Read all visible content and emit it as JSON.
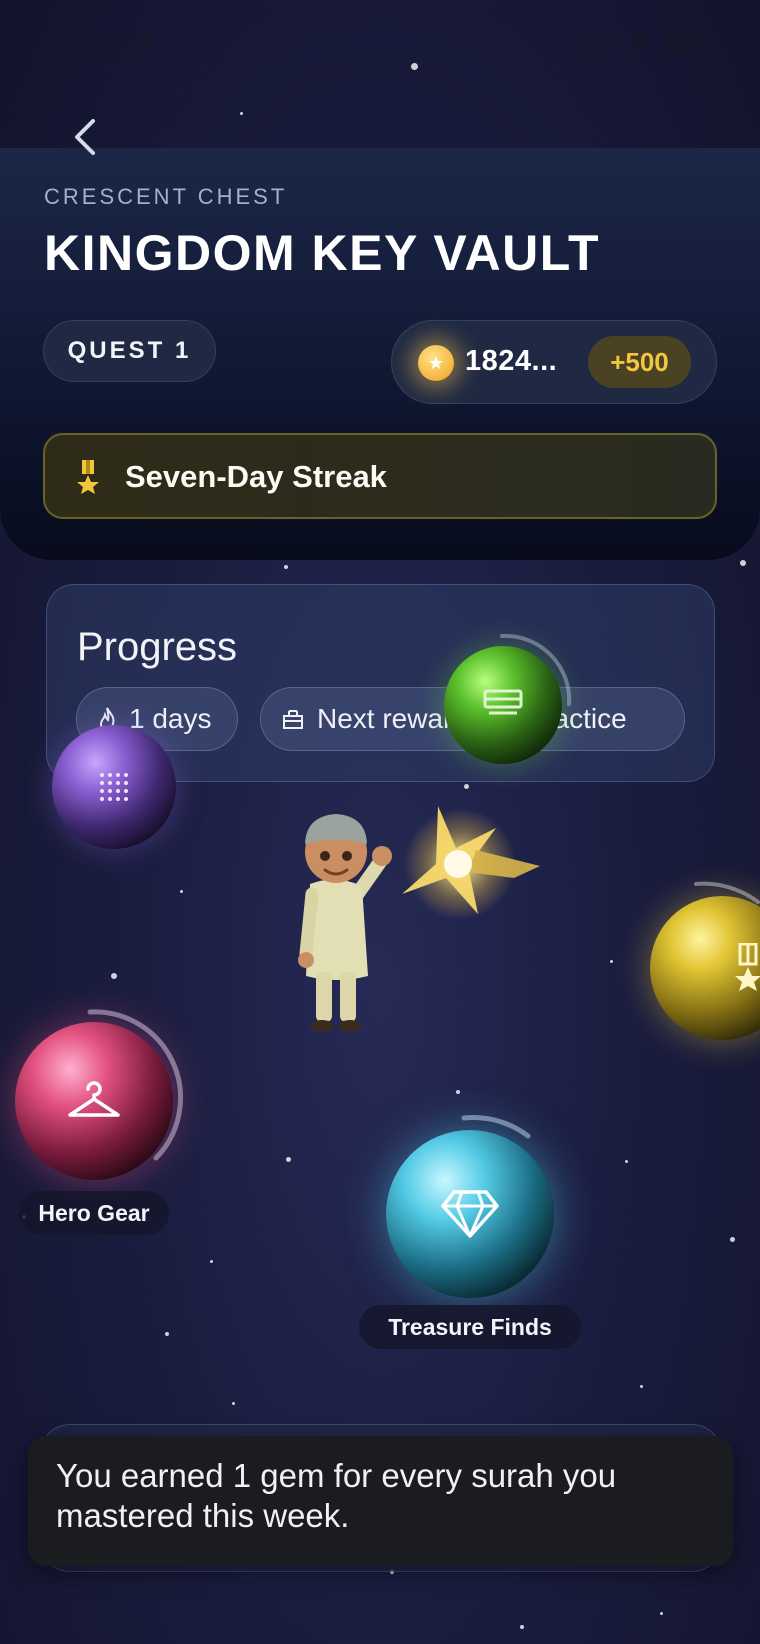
{
  "status_bar": {
    "time": "11:20"
  },
  "header": {
    "eyebrow": "CRESCENT CHEST",
    "title": "KINGDOM KEY VAULT",
    "quest_label": "QUEST 1",
    "coins": {
      "value": "1824...",
      "bonus": "+500"
    },
    "streak_label": "Seven-Day Streak"
  },
  "progress": {
    "title": "Progress",
    "days_chip": "1 days",
    "reward_chip": "Next reward in 1 practice"
  },
  "orbs": [
    {
      "name": "purple-orb",
      "icon": "dots-grid-icon",
      "color": "#8a5fd1"
    },
    {
      "name": "green-orb",
      "icon": "card-icon",
      "color": "#5cc12c",
      "progress": 0.3
    },
    {
      "name": "yellow-orb",
      "icon": "medal-icon",
      "color": "#e1c534",
      "progress": 0.15
    },
    {
      "name": "pink-orb",
      "icon": "hanger-icon",
      "color": "#e2507f",
      "label": "Hero Gear",
      "progress": 0.35
    },
    {
      "name": "cyan-orb",
      "icon": "diamond-icon",
      "color": "#54cbe6",
      "label": "Treasure Finds",
      "progress": 0.12
    }
  ],
  "toast": {
    "message": "You earned 1 gem for every surah you mastered this week."
  },
  "colors": {
    "gold": "#f4c63f",
    "background": "#1b1d40"
  }
}
